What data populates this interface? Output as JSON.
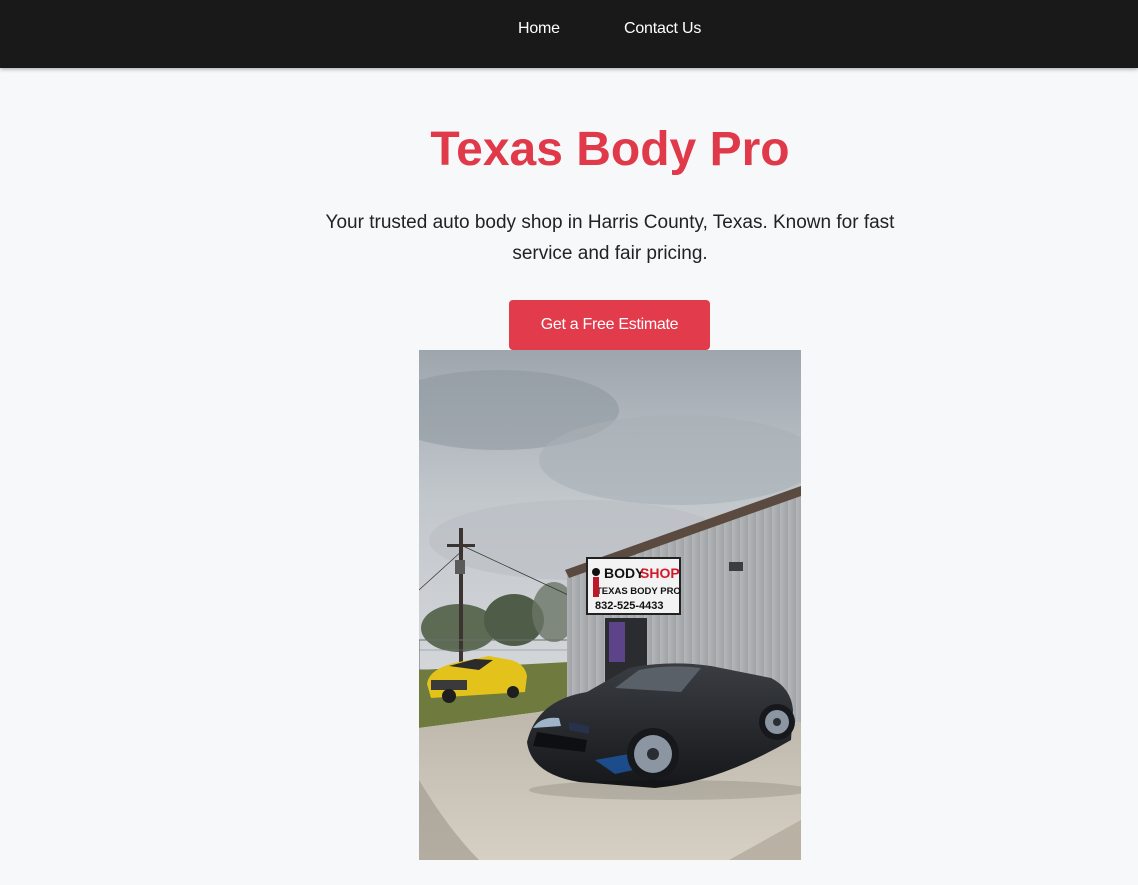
{
  "nav": {
    "home_label": "Home",
    "contact_label": "Contact Us"
  },
  "hero": {
    "title": "Texas Body Pro",
    "subtitle": "Your trusted auto body shop in Harris County, Texas. Known for fast service and fair pricing.",
    "cta_label": "Get a Free Estimate"
  },
  "photo": {
    "sign_line1_left": "BODY",
    "sign_line1_right": "SHOP",
    "sign_line2": "TEXAS BODY PRO",
    "sign_line3": "832-525-4433"
  },
  "colors": {
    "nav_bg": "#191919",
    "accent": "#e03a4a",
    "page_bg": "#f6f8fa"
  }
}
